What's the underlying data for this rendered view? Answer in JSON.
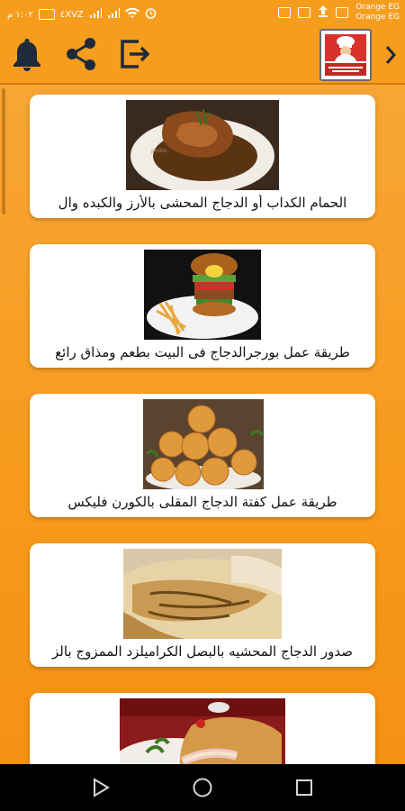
{
  "status_bar": {
    "time": "١:٠٢ م",
    "network": "٤XVZ",
    "carrier_1": "Orange EG",
    "carrier_2": "Orange EG"
  },
  "toolbar": {
    "icons": [
      "bell-icon",
      "share-icon",
      "exit-icon",
      "chef-logo",
      "chevron-right-icon"
    ]
  },
  "recipes": [
    {
      "title": "الحمام الكداب أو الدجاج المحشى بالأرز والكبده وال",
      "image": "roast-chicken-photo"
    },
    {
      "title": "طريقة عمل بورجرالدجاج فى البيت بطعم ومذاق رائع",
      "image": "chicken-burger-photo"
    },
    {
      "title": "طريقة عمل كفتة الدجاج المقلى بالكورن فليكس",
      "image": "chicken-balls-photo"
    },
    {
      "title": "صدور الدجاج المحشيه بالبصل الكراميلزد الممزوج بالز",
      "image": "stuffed-chicken-breast-photo"
    },
    {
      "title": "",
      "image": "chicken-cordon-bleu-photo"
    }
  ],
  "colors": {
    "accent": "#f79d1e",
    "background": "#f79a1c",
    "card": "#ffffff",
    "nav_bar": "#000000"
  }
}
